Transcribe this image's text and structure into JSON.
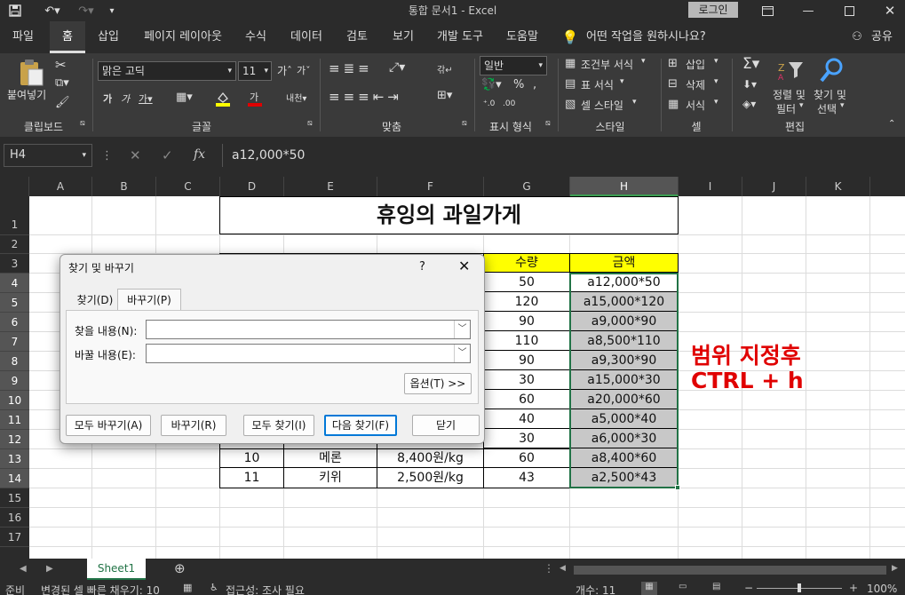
{
  "window": {
    "title": "통합 문서1  -  Excel",
    "login_label": "로그인"
  },
  "ribbon_tabs": [
    "파일",
    "홈",
    "삽입",
    "페이지 레이아웃",
    "수식",
    "데이터",
    "검토",
    "보기",
    "개발 도구",
    "도움말"
  ],
  "tell_me": "어떤 작업을 원하시나요?",
  "share_label": "공유",
  "ribbon": {
    "clipboard": {
      "paste": "붙여넣기",
      "label": "클립보드"
    },
    "font": {
      "name": "맑은 고딕",
      "size": "11",
      "label": "글꼴"
    },
    "alignment": {
      "label": "맞춤"
    },
    "number": {
      "format": "일반",
      "label": "표시 형식"
    },
    "styles": {
      "conditional": "조건부 서식",
      "table": "표 서식",
      "cell": "셀 스타일",
      "label": "스타일"
    },
    "cells": {
      "insert": "삽입",
      "delete": "삭제",
      "format": "서식",
      "label": "셀"
    },
    "editing": {
      "sort": "정렬 및",
      "filter": "필터",
      "find": "찾기 및",
      "select": "선택",
      "label": "편집"
    }
  },
  "formula_bar": {
    "name_box": "H4",
    "formula": "a12,000*50"
  },
  "columns": [
    "A",
    "B",
    "C",
    "D",
    "E",
    "F",
    "G",
    "H",
    "I",
    "J",
    "K"
  ],
  "rows": [
    "1",
    "2",
    "3",
    "4",
    "5",
    "6",
    "7",
    "8",
    "9",
    "10",
    "11",
    "12",
    "13",
    "14",
    "15",
    "16",
    "17"
  ],
  "sheet": {
    "title": "휴잉의 과일가게",
    "header_g": "수량",
    "header_h": "금액",
    "data_rows": [
      {
        "g": "50",
        "h": "a12,000*50"
      },
      {
        "g": "120",
        "h": "a15,000*120"
      },
      {
        "g": "90",
        "h": "a9,000*90"
      },
      {
        "g": "110",
        "h": "a8,500*110"
      },
      {
        "g": "90",
        "h": "a9,300*90"
      },
      {
        "g": "30",
        "h": "a15,000*30"
      },
      {
        "g": "60",
        "h": "a20,000*60"
      },
      {
        "g": "40",
        "h": "a5,000*40"
      },
      {
        "g": "30",
        "h": "a6,000*30"
      },
      {
        "d": "10",
        "e": "메론",
        "f": "8,400원/kg",
        "g": "60",
        "h": "a8,400*60"
      },
      {
        "d": "11",
        "e": "키위",
        "f": "2,500원/kg",
        "g": "43",
        "h": "a2,500*43"
      }
    ],
    "annotation_line1": "범위 지정후",
    "annotation_line2": "CTRL + h",
    "annotation_color": "#e00000",
    "header_fill": "#ffff00",
    "selection_fill": "#c8c8c8"
  },
  "dialog": {
    "title": "찾기 및 바꾸기",
    "help": "?",
    "tab_find": "찾기(D)",
    "tab_replace": "바꾸기(P)",
    "find_label": "찾을 내용(N):",
    "replace_label": "바꿀 내용(E):",
    "options_btn": "옵션(T) >>",
    "replace_all": "모두 바꾸기(A)",
    "replace": "바꾸기(R)",
    "find_all": "모두 찾기(I)",
    "find_next": "다음 찾기(F)",
    "close": "닫기"
  },
  "sheet_tab": "Sheet1",
  "status": {
    "ready": "준비",
    "flash_fill": "변경된 셀 빠른 채우기: 10",
    "accessibility": "접근성: 조사 필요",
    "count": "개수: 11",
    "zoom": "100%"
  }
}
